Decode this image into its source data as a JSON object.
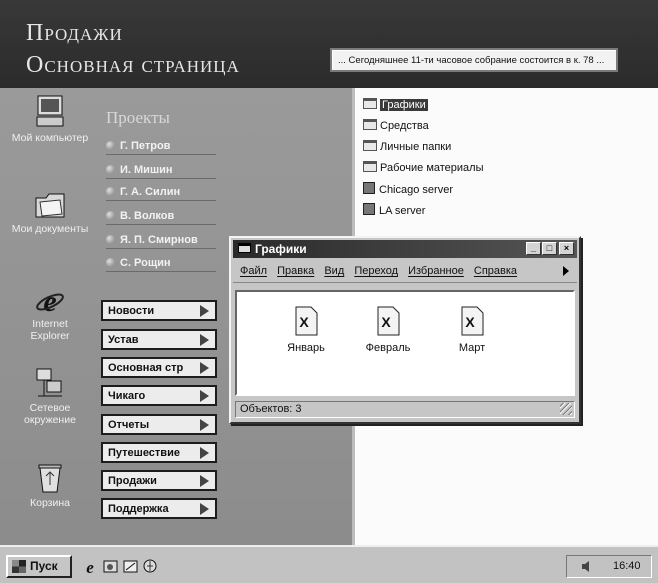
{
  "banner": {
    "title_line1": "Продажи",
    "title_line2": "Основная страница",
    "ticker": "... Сегодняшнее 11-ти часовое собрание состоится в к. 78 ..."
  },
  "desktop_icons": [
    {
      "label": "Мой компьютер",
      "icon": "my-computer-icon"
    },
    {
      "label": "Мои документы",
      "icon": "my-documents-icon"
    },
    {
      "label": "Internet Explorer",
      "icon": "internet-explorer-icon"
    },
    {
      "label": "Сетевое окружение",
      "icon": "network-neighborhood-icon"
    },
    {
      "label": "Корзина",
      "icon": "recycle-bin-icon"
    }
  ],
  "projects": {
    "heading": "Проекты",
    "people": [
      "Г. Петров",
      "И. Мишин",
      "Г. А. Силин",
      "В. Волков",
      "Я. П. Смирнов",
      "С. Рощин"
    ]
  },
  "nav_buttons": [
    "Новости",
    "Устав",
    "Основная стр",
    "Чикаго",
    "Отчеты",
    "Путешествие",
    "Продажи",
    "Поддержка"
  ],
  "folder_tree": [
    {
      "label": "Графики",
      "type": "folder",
      "selected": true
    },
    {
      "label": "Средства",
      "type": "folder"
    },
    {
      "label": "Личные папки",
      "type": "folder"
    },
    {
      "label": "Рабочие материалы",
      "type": "folder"
    },
    {
      "label": "Chicago server",
      "type": "server"
    },
    {
      "label": "LA server",
      "type": "server"
    }
  ],
  "window": {
    "title": "Графики",
    "minimize": "_",
    "maximize": "□",
    "close": "×",
    "menu": [
      "Файл",
      "Правка",
      "Вид",
      "Переход",
      "Избранное",
      "Справка"
    ],
    "files": [
      "Январь",
      "Февраль",
      "Март"
    ],
    "status": "Объектов: 3"
  },
  "taskbar": {
    "start_label": "Пуск",
    "clock": "16:40"
  },
  "colors": {
    "banner": "#2b2b2b",
    "desktop": "#8e8e8e",
    "window_title": "#2a2a2a",
    "taskbar": "#c2c2c2"
  }
}
